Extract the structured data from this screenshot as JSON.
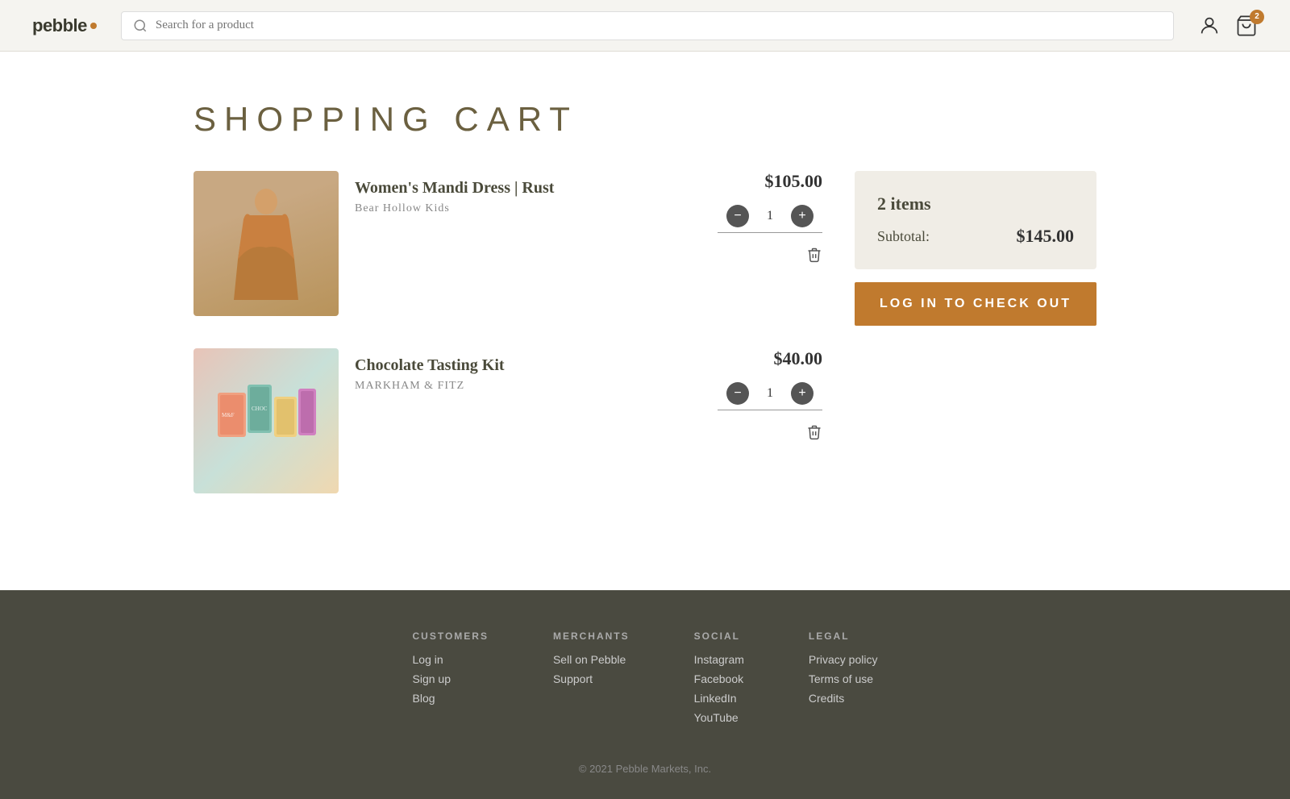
{
  "header": {
    "logo_text": "pebble.",
    "search_placeholder": "Search for a product",
    "cart_badge": "2"
  },
  "page": {
    "title": "SHOPPING CART"
  },
  "cart": {
    "items": [
      {
        "id": "item-1",
        "name": "Women's Mandi Dress | Rust",
        "brand": "Bear Hollow Kids",
        "price": "$105.00",
        "quantity": 1,
        "image_type": "dress"
      },
      {
        "id": "item-2",
        "name": "Chocolate Tasting Kit",
        "brand": "MARKHAM & FITZ",
        "price": "$40.00",
        "quantity": 1,
        "image_type": "choco"
      }
    ],
    "summary": {
      "items_count": "2 items",
      "subtotal_label": "Subtotal:",
      "subtotal_amount": "$145.00",
      "checkout_label": "LOG IN TO CHECK OUT"
    }
  },
  "footer": {
    "columns": [
      {
        "heading": "CUSTOMERS",
        "links": [
          "Log in",
          "Sign up",
          "Blog"
        ]
      },
      {
        "heading": "MERCHANTS",
        "links": [
          "Sell on Pebble",
          "Support"
        ]
      },
      {
        "heading": "SOCIAL",
        "links": [
          "Instagram",
          "Facebook",
          "LinkedIn",
          "YouTube"
        ]
      },
      {
        "heading": "LEGAL",
        "links": [
          "Privacy policy",
          "Terms of use",
          "Credits"
        ]
      }
    ],
    "copyright": "© 2021 Pebble Markets, Inc."
  }
}
